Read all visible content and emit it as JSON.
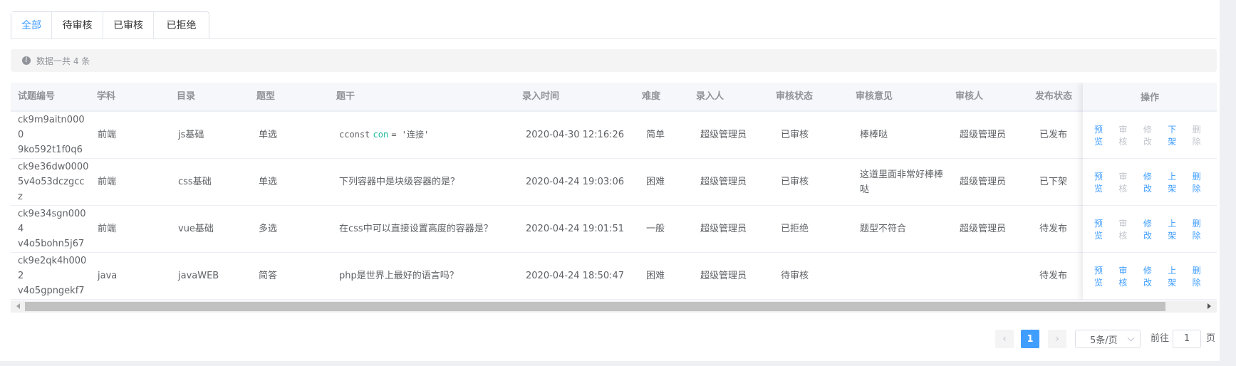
{
  "tabs": [
    {
      "label": "全部",
      "active": true
    },
    {
      "label": "待审核",
      "active": false
    },
    {
      "label": "已审核",
      "active": false
    },
    {
      "label": "已拒绝",
      "active": false
    }
  ],
  "alert": {
    "text": "数据一共 4 条",
    "icon": "info-icon"
  },
  "table": {
    "headers": {
      "id": "试题编号",
      "subject": "学科",
      "catalog": "目录",
      "type": "题型",
      "stem": "题干",
      "time": "录入时间",
      "difficulty": "难度",
      "creator": "录入人",
      "audit_status": "审核状态",
      "audit_opinion": "审核意见",
      "auditor": "审核人",
      "publish_status": "发布状态",
      "actions": "操作"
    },
    "rows": [
      {
        "id": "ck9m9aitn0000\n9ko592t1f0q6",
        "subject": "前端",
        "catalog": "js基础",
        "type": "单选",
        "stem_parts": [
          "cconst",
          "con",
          "= '连接'"
        ],
        "time": "2020-04-30 12:16:26",
        "difficulty": "简单",
        "creator": "超级管理员",
        "audit_status": "已审核",
        "audit_opinion": "棒棒哒",
        "auditor": "超级管理员",
        "publish_status": "已发布",
        "actions": [
          {
            "label": "预览",
            "enabled": true
          },
          {
            "label": "审核",
            "enabled": false
          },
          {
            "label": "修改",
            "enabled": false
          },
          {
            "label": "下架",
            "enabled": true
          },
          {
            "label": "删除",
            "enabled": false
          }
        ]
      },
      {
        "id": "ck9e36dw0000\n5v4o53dczgccz",
        "subject": "前端",
        "catalog": "css基础",
        "type": "单选",
        "stem": "下列容器中是块级容器的是？",
        "time": "2020-04-24 19:03:06",
        "difficulty": "困难",
        "creator": "超级管理员",
        "audit_status": "已审核",
        "audit_opinion": "这道里面非常好棒棒\n哒",
        "auditor": "超级管理员",
        "publish_status": "已下架",
        "actions": [
          {
            "label": "预览",
            "enabled": true
          },
          {
            "label": "审核",
            "enabled": false
          },
          {
            "label": "修改",
            "enabled": true
          },
          {
            "label": "上架",
            "enabled": true
          },
          {
            "label": "删除",
            "enabled": true
          }
        ]
      },
      {
        "id": "ck9e34sgn0004\nv4o5bohn5j67",
        "subject": "前端",
        "catalog": "vue基础",
        "type": "多选",
        "stem": "在css中可以直接设置高度的容器是？",
        "time": "2020-04-24 19:01:51",
        "difficulty": "一般",
        "creator": "超级管理员",
        "audit_status": "已拒绝",
        "audit_opinion": "题型不符合",
        "auditor": "超级管理员",
        "publish_status": "待发布",
        "actions": [
          {
            "label": "预览",
            "enabled": true
          },
          {
            "label": "审核",
            "enabled": false
          },
          {
            "label": "修改",
            "enabled": true
          },
          {
            "label": "上架",
            "enabled": true
          },
          {
            "label": "删除",
            "enabled": true
          }
        ]
      },
      {
        "id": "ck9e2qk4h0002\nv4o5gpngekf7",
        "subject": "java",
        "catalog": "javaWEB",
        "type": "简答",
        "stem": "php是世界上最好的语言吗？",
        "time": "2020-04-24 18:50:47",
        "difficulty": "困难",
        "creator": "超级管理员",
        "audit_status": "待审核",
        "audit_opinion": "",
        "auditor": "",
        "publish_status": "待发布",
        "actions": [
          {
            "label": "预览",
            "enabled": true
          },
          {
            "label": "审核",
            "enabled": true
          },
          {
            "label": "修改",
            "enabled": true
          },
          {
            "label": "上架",
            "enabled": true
          },
          {
            "label": "删除",
            "enabled": true
          }
        ]
      }
    ]
  },
  "pagination": {
    "prev_icon": "chevron-left-icon",
    "next_icon": "chevron-right-icon",
    "current_page": "1",
    "page_size_label": "5条/页",
    "goto_prefix": "前往",
    "goto_value": "1",
    "goto_suffix": "页"
  },
  "colors": {
    "primary": "#409eff",
    "disabled": "#c0c4cc",
    "code_var": "#1eb8a0"
  }
}
